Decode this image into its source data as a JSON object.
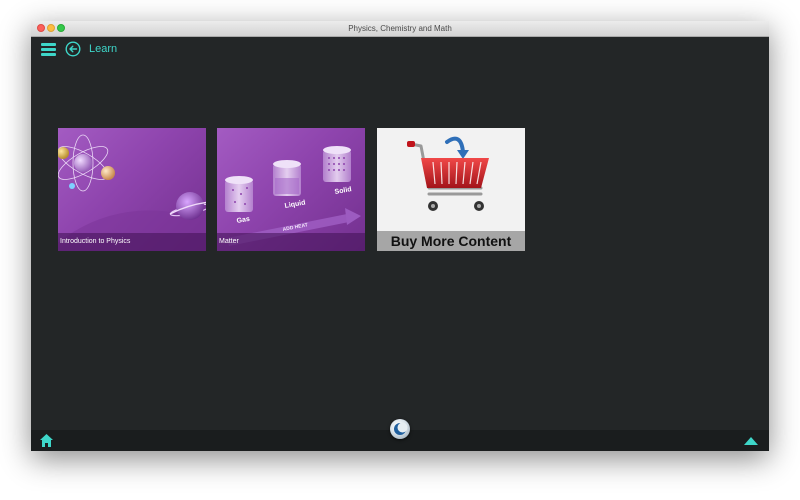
{
  "window": {
    "title": "Physics, Chemistry and Math"
  },
  "header": {
    "title": "Learn",
    "menu_icon": "hamburger-menu-icon",
    "back_icon": "back-arrow-icon"
  },
  "tiles": [
    {
      "caption": "Introduction to Physics"
    },
    {
      "caption": "Matter",
      "art_labels": {
        "gas": "Gas",
        "liquid": "Liquid",
        "solid": "Solid",
        "arrow": "ADD HEAT"
      }
    },
    {
      "caption": "Buy More Content"
    }
  ],
  "footer": {
    "home_icon": "home-icon",
    "center_icon": "moon-orb-icon",
    "up_icon": "up-arrow-icon"
  },
  "colors": {
    "accent": "#3ed6c9",
    "background": "#232627",
    "tile_purple": "#8e44ad"
  }
}
